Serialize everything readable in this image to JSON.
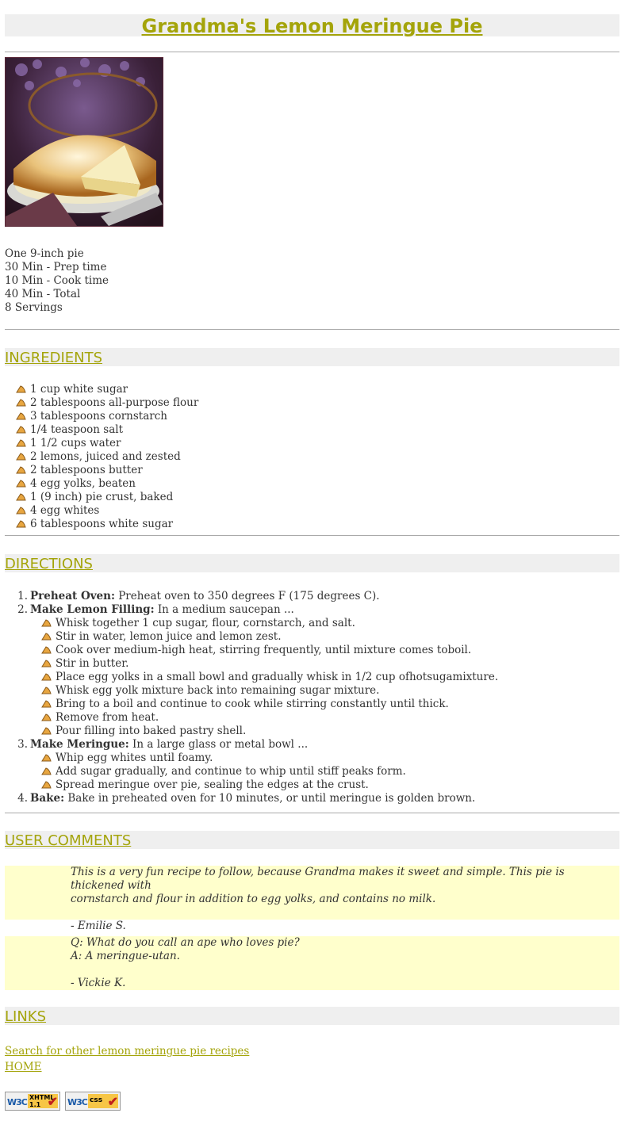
{
  "title": "Grandma's Lemon Meringue Pie",
  "facts": [
    "One 9-inch pie",
    "30 Min - Prep time",
    "10 Min - Cook time",
    "40 Min - Total",
    "8 Servings"
  ],
  "sections": {
    "ingredients": "INGREDIENTS",
    "directions": "DIRECTIONS",
    "comments": "USER COMMENTS",
    "links": "LINKS"
  },
  "ingredients": [
    "1 cup white sugar",
    "2 tablespoons all-purpose flour",
    "3 tablespoons cornstarch",
    "1/4 teaspoon salt",
    "1 1/2 cups water",
    "2 lemons, juiced and zested",
    "2 tablespoons butter",
    "4 egg yolks, beaten",
    "1 (9 inch) pie crust, baked",
    "4 egg whites",
    "6 tablespoons white sugar"
  ],
  "directions": [
    {
      "num": "1.",
      "head": "Preheat Oven:",
      "text": " Preheat oven to 350 degrees F (175 degrees C).",
      "sub": []
    },
    {
      "num": "2.",
      "head": "Make Lemon Filling:",
      "text": " In a medium saucepan ...",
      "sub": [
        "Whisk together 1 cup sugar, flour, cornstarch, and salt.",
        "Stir in water, lemon juice and lemon zest.",
        "Cook over medium-high heat, stirring frequently, until mixture comes toboil.",
        "Stir in butter.",
        "Place egg yolks in a small bowl and gradually whisk in 1/2 cup ofhotsugamixture.",
        "Whisk egg yolk mixture back into remaining sugar mixture.",
        "Bring to a boil and continue to cook while stirring constantly until thick.",
        "Remove from heat.",
        "Pour filling into baked pastry shell."
      ]
    },
    {
      "num": "3.",
      "head": "Make Meringue:",
      "text": " In a large glass or metal bowl ...",
      "sub": [
        "Whip egg whites until foamy.",
        "Add sugar gradually, and continue to whip until stiff peaks form.",
        "Spread meringue over pie, sealing the edges at the crust."
      ]
    },
    {
      "num": "4.",
      "head": "Bake:",
      "text": " Bake in preheated oven for 10 minutes, or until meringue is golden brown.",
      "sub": []
    }
  ],
  "comments": [
    {
      "lines": [
        "This is a very fun recipe to follow, because Grandma makes it sweet and simple. This pie is thickened with",
        "cornstarch and flour in addition to egg yolks, and contains no milk."
      ],
      "author": "- Emilie S."
    },
    {
      "lines": [
        "Q: What do you call an ape who loves pie?",
        "A: A meringue-utan."
      ],
      "author": "- Vickie K."
    }
  ],
  "links": [
    "Search for other lemon meringue pie recipes",
    "HOME"
  ],
  "badges": [
    {
      "w3": "W3C",
      "tag1": "XHTML",
      "tag2": "1.1"
    },
    {
      "w3": "W3C",
      "tag1": "css",
      "tag2": ""
    }
  ],
  "colors": {
    "accent": "#a4a40a",
    "section_bg": "#efefef",
    "comment_bg": "#ffffcc",
    "bullet": "#e8a640"
  }
}
